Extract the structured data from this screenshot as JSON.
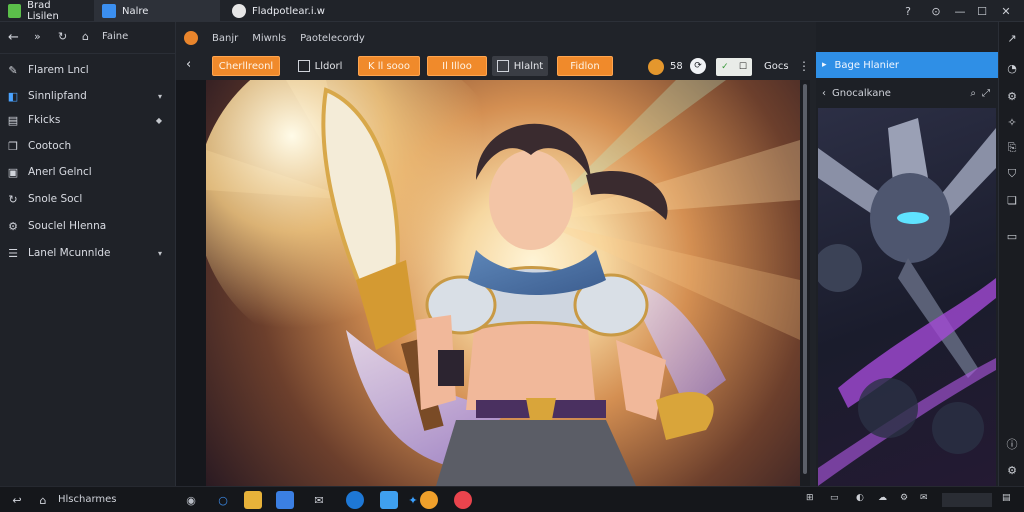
{
  "tabs": [
    {
      "label": "Brad Lisilen",
      "icon": "app-icon",
      "active": false
    },
    {
      "label": "Nalre",
      "icon": "document-icon",
      "active": true
    },
    {
      "label": "Fladpotlear.i.w",
      "icon": "github-icon",
      "active": false
    }
  ],
  "window_controls": [
    "help",
    "minimize",
    "maximize",
    "close"
  ],
  "sidebar": {
    "nav_label": "Faine",
    "items": [
      {
        "label": "Flarem Lncl",
        "icon": "brush-icon",
        "chevron": ""
      },
      {
        "label": "Sinnlipfand",
        "icon": "layers-icon",
        "chevron": "▾"
      },
      {
        "label": "Fkicks",
        "icon": "page-icon",
        "chevron": "◆"
      },
      {
        "label": "Cootoch",
        "icon": "copy-icon",
        "chevron": ""
      },
      {
        "label": "Anerl Gelncl",
        "icon": "folder-icon",
        "chevron": ""
      },
      {
        "label": "Snole Socl",
        "icon": "refresh-icon",
        "chevron": ""
      },
      {
        "label": "Souclel Hlenna",
        "icon": "settings-icon",
        "chevron": ""
      },
      {
        "label": "Lanel Mcunnlde",
        "icon": "list-icon",
        "chevron": "▾"
      }
    ]
  },
  "breadcrumb": [
    "Banjr",
    "Miwnls",
    "Paotelecordy"
  ],
  "toolbar": {
    "buttons": [
      {
        "label": "Cherllreonl",
        "style": "orange"
      },
      {
        "label": "Lldorl",
        "style": "dark"
      },
      {
        "label": "K ll sooo",
        "style": "orange"
      },
      {
        "label": "Il Illoo",
        "style": "orange"
      },
      {
        "label": "Hlalnt",
        "style": "dark"
      },
      {
        "label": "Fidlon",
        "style": "orange"
      }
    ],
    "count": "58",
    "send_label": "Gocs"
  },
  "right_panel": {
    "header_label": "Bage Hlanier",
    "search_label": "Gnocalkane"
  },
  "taskbar": {
    "search_label": "Hlscharmes"
  },
  "colors": {
    "accent_orange": "#f08a2b",
    "accent_blue": "#2f8fe6",
    "bg_dark": "#1b1d24"
  }
}
